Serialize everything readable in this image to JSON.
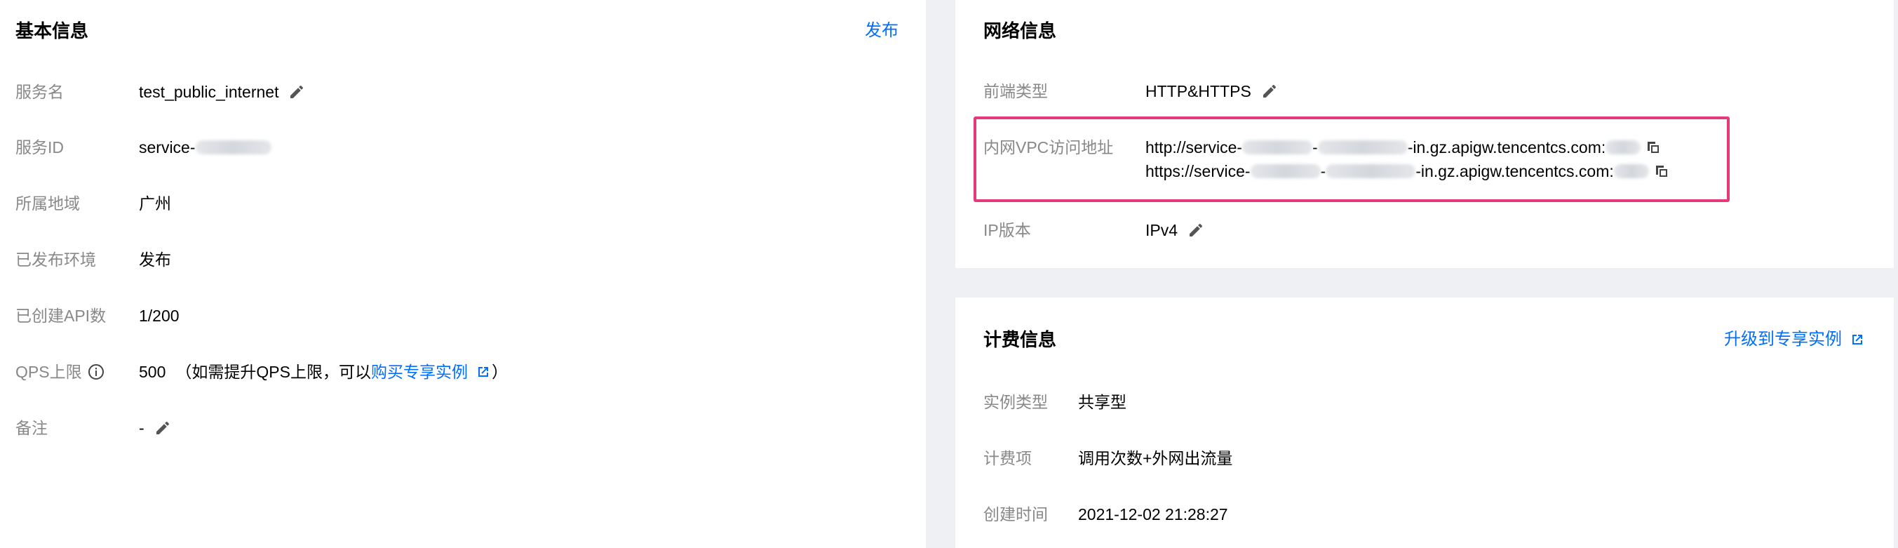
{
  "basic": {
    "title": "基本信息",
    "publish_action": "发布",
    "rows": [
      {
        "label": "服务名",
        "value": "test_public_internet"
      },
      {
        "label": "服务ID",
        "value": "service-"
      },
      {
        "label": "所属地域",
        "value": "广州"
      },
      {
        "label": "已发布环境",
        "value": "发布"
      },
      {
        "label": "已创建API数",
        "value": "1/200"
      },
      {
        "label": "QPS上限",
        "value": "500",
        "note_prefix": "（如需提升QPS上限，可以",
        "note_link": "购买专享实例",
        "note_suffix": "）"
      },
      {
        "label": "备注",
        "value": "-"
      }
    ]
  },
  "network": {
    "title": "网络信息",
    "rows": [
      {
        "label": "前端类型",
        "value": "HTTP&HTTPS"
      },
      {
        "label": "内网VPC访问地址",
        "http_prefix": "http://service-",
        "https_prefix": "https://service-",
        "dash": "-",
        "suffix": "-in.gz.apigw.tencentcs.com:"
      },
      {
        "label": "IP版本",
        "value": "IPv4"
      }
    ]
  },
  "billing": {
    "title": "计费信息",
    "upgrade_action": "升级到专享实例",
    "rows": [
      {
        "label": "实例类型",
        "value": "共享型"
      },
      {
        "label": "计费项",
        "value": "调用次数+外网出流量"
      },
      {
        "label": "创建时间",
        "value": "2021-12-02 21:28:27"
      }
    ]
  },
  "colors": {
    "accent": "#006eff",
    "highlight_border": "#e5397a",
    "label": "#888888"
  }
}
